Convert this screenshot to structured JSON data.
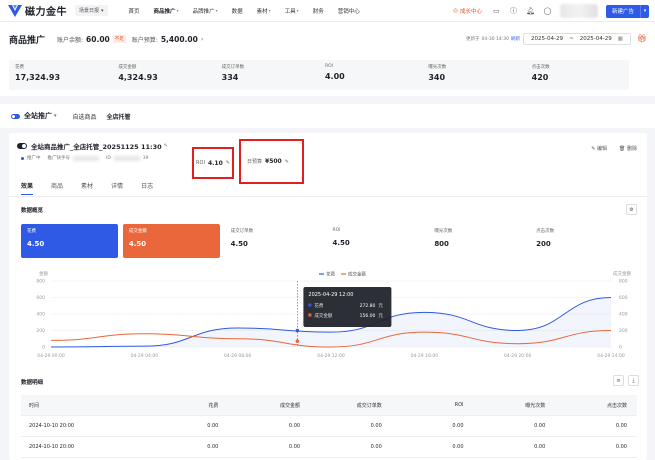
{
  "app": {
    "logo_text": "磁力金牛",
    "account_selector": "场景日报"
  },
  "nav": [
    {
      "label": "首页",
      "active": false,
      "dropdown": false
    },
    {
      "label": "商品推广",
      "active": true,
      "dropdown": true
    },
    {
      "label": "品牌推广",
      "active": false,
      "dropdown": true
    },
    {
      "label": "数据",
      "active": false,
      "dropdown": false
    },
    {
      "label": "素材",
      "active": false,
      "dropdown": true
    },
    {
      "label": "工具",
      "active": false,
      "dropdown": true
    },
    {
      "label": "财务",
      "active": false,
      "dropdown": false
    },
    {
      "label": "营销中心",
      "active": false,
      "dropdown": false
    }
  ],
  "topright": {
    "growth_label": "成长中心",
    "new_ad_label": "新建广告"
  },
  "page": {
    "title": "商品推广",
    "balance_label": "账户余额:",
    "balance_value": "60.00",
    "balance_tag": "不足",
    "budget_label": "账户预算:",
    "budget_value": "5,400.00",
    "updated_label": "更新于",
    "updated_time": "04-30 14:30",
    "refresh_label": "刷新",
    "date_start": "2025-04-29",
    "date_sep": "~",
    "date_end": "2025-04-29"
  },
  "metrics": [
    {
      "label": "花费",
      "value": "17,324.93"
    },
    {
      "label": "成交金额",
      "value": "4,324.93"
    },
    {
      "label": "成交订单数",
      "value": "334"
    },
    {
      "label": "ROI",
      "value": "4.00"
    },
    {
      "label": "曝光次数",
      "value": "340"
    },
    {
      "label": "点击次数",
      "value": "420"
    }
  ],
  "mode_tabs": {
    "main": "全站推广",
    "sub1": "自选商品",
    "sub2": "全店托管"
  },
  "campaign": {
    "name": "全站商品推广_全店托管_20251125 11:30",
    "status": "推广中",
    "account_label": "推广快手号",
    "id_label": "ID",
    "id_suffix": "39",
    "roi_label": "ROI",
    "roi_value": "4.10",
    "budget_label": "日预算",
    "budget_value": "¥500",
    "edit_label": "编辑",
    "delete_label": "删除"
  },
  "content_tabs": [
    "效果",
    "商品",
    "素材",
    "详情",
    "日志"
  ],
  "overview": {
    "title": "数据概览"
  },
  "kpis": [
    {
      "label": "花费",
      "value": "4.50"
    },
    {
      "label": "成交金额",
      "value": "4.50"
    },
    {
      "label": "成交订单数",
      "value": "4.50"
    },
    {
      "label": "ROI",
      "value": "4.50"
    },
    {
      "label": "曝光次数",
      "value": "800"
    },
    {
      "label": "点击次数",
      "value": "200"
    }
  ],
  "chart_data": {
    "type": "line",
    "left_axis_label": "金额",
    "right_axis_label": "成交金额",
    "y_left_ticks": [
      "800",
      "600",
      "400",
      "200",
      "0"
    ],
    "y_right_ticks": [
      "800",
      "600",
      "400",
      "200",
      "0"
    ],
    "ylim": [
      0,
      800
    ],
    "x": [
      "04-29 00:00",
      "04-29 04:00",
      "04-29 08:00",
      "04-29 12:00",
      "04-29 16:00",
      "04-29 20:00",
      "04-29 24:00"
    ],
    "series": [
      {
        "name": "花费",
        "color": "#2f5ae5",
        "values": [
          0,
          10,
          230,
          180,
          420,
          200,
          600
        ]
      },
      {
        "name": "成交金额",
        "color": "#e9673a",
        "values": [
          80,
          160,
          100,
          0,
          180,
          40,
          200
        ]
      }
    ],
    "tooltip": {
      "title": "2025-04-29 12:00",
      "rows": [
        {
          "name": "花费",
          "value": "272.80",
          "unit": "元"
        },
        {
          "name": "成交金额",
          "value": "156.00",
          "unit": "元"
        }
      ]
    }
  },
  "detail": {
    "title": "数据明细",
    "columns": [
      "时间",
      "花费",
      "成交金额",
      "成交订单数",
      "ROI",
      "曝光次数",
      "点击次数"
    ],
    "rows": [
      [
        "2024-10-10 20:00",
        "0.00",
        "0.00",
        "0.00",
        "0.00",
        "0.00",
        "0.00"
      ],
      [
        "2024-10-10 20:00",
        "0.00",
        "0.00",
        "0.00",
        "0.00",
        "0.00",
        "0.00"
      ]
    ]
  }
}
